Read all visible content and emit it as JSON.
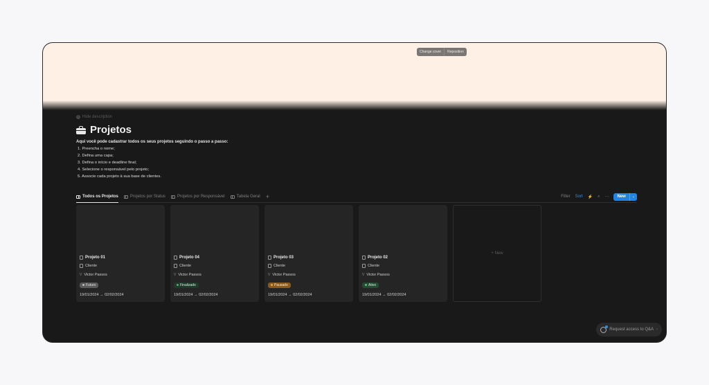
{
  "cover": {
    "change_cover": "Change cover",
    "reposition": "Reposition",
    "color": "#fef0e4"
  },
  "description": {
    "hide_label": "Hide description"
  },
  "page": {
    "title": "Projetos",
    "icon": "briefcase-icon",
    "intro": "Aqui você pode cadastrar todos os seus projetos seguindo o passo a passo:",
    "steps": [
      "1. Preencha o nome;",
      "2. Defina uma capa;",
      "3. Defina o início e deadline final;",
      "4. Selecione o responsável pelo projeto;",
      "5. Associe cada projeto à sua base de clientes."
    ]
  },
  "views": {
    "tabs": [
      {
        "label": "Todos os Projetos",
        "icon": "gallery-icon",
        "active": true
      },
      {
        "label": "Projetos por Status",
        "icon": "board-icon",
        "active": false
      },
      {
        "label": "Projetos por Responsável",
        "icon": "board-icon",
        "active": false
      },
      {
        "label": "Tabela Geral",
        "icon": "table-icon",
        "active": false
      }
    ],
    "add": "+"
  },
  "toolbar": {
    "filter": "Filter",
    "sort": "Sort",
    "lightning": "⚡",
    "search": "⌕",
    "more": "···",
    "new": "New",
    "caret": "⌄"
  },
  "cards": [
    {
      "name": "Projeto 01",
      "client": "Cliente",
      "person": "Victor Passos",
      "status": "Futuro",
      "status_bg": "#5a5a5a",
      "status_fg": "#e0e0e0",
      "status_dot": "#bdbdbd",
      "dates": "19/01/2024 → 02/02/2024"
    },
    {
      "name": "Projeto 04",
      "client": "Cliente",
      "person": "Victor Passos",
      "status": "Finalizado",
      "status_bg": "#1f3a2a",
      "status_fg": "#d8eedd",
      "status_dot": "#4fb06d",
      "dates": "19/01/2024 → 02/02/2024"
    },
    {
      "name": "Projeto 03",
      "client": "Cliente",
      "person": "Victor Passos",
      "status": "Pausado",
      "status_bg": "#8a5a1c",
      "status_fg": "#fbe6c8",
      "status_dot": "#e8a54a",
      "dates": "19/01/2024 → 02/02/2024"
    },
    {
      "name": "Projeto 02",
      "client": "Cliente",
      "person": "Victor Passos",
      "status": "Ativo",
      "status_bg": "#264b33",
      "status_fg": "#d8f0de",
      "status_dot": "#5cc07e",
      "dates": "19/01/2024 → 02/02/2024"
    }
  ],
  "new_card": {
    "label": "+ New"
  },
  "qa": {
    "label": "Request access to Q&A",
    "arrow": "›"
  }
}
